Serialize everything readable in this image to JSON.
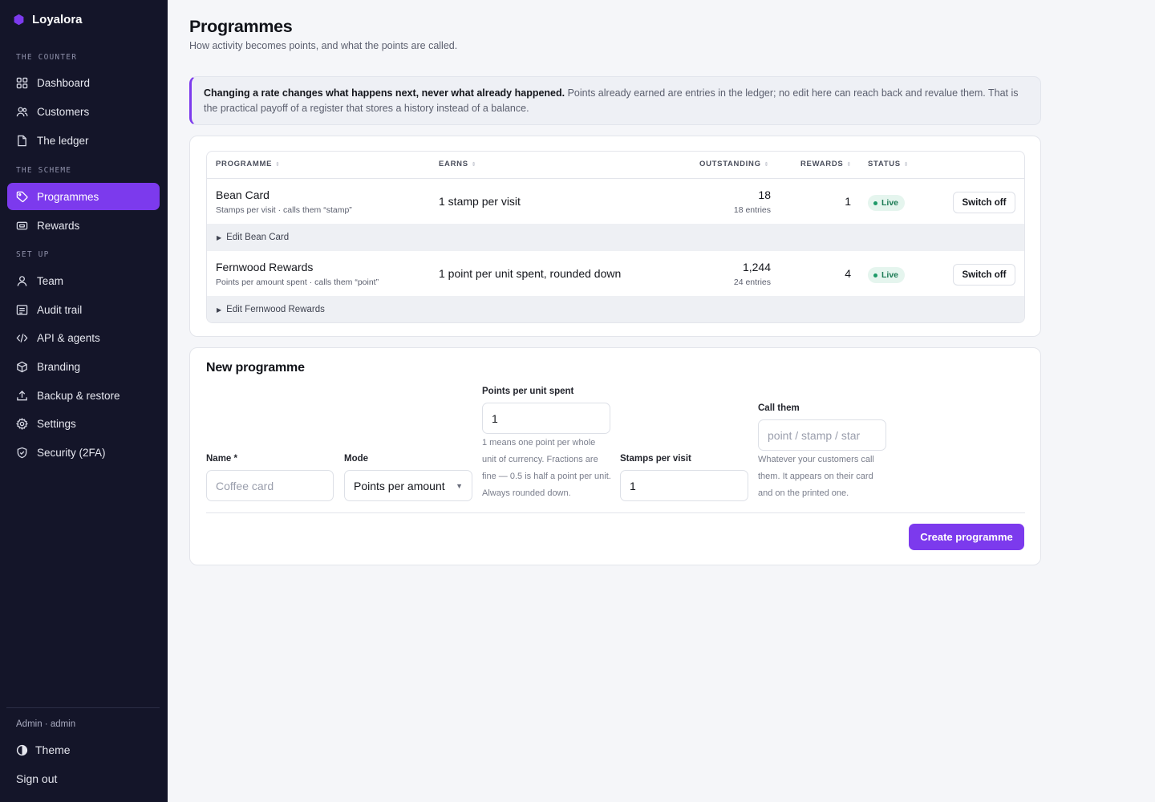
{
  "app": {
    "name": "Loyalora"
  },
  "sidebar": {
    "sections": [
      {
        "label": "THE COUNTER",
        "items": [
          {
            "label": "Dashboard",
            "icon": "grid-icon"
          },
          {
            "label": "Customers",
            "icon": "users-icon"
          },
          {
            "label": "The ledger",
            "icon": "document-icon"
          }
        ]
      },
      {
        "label": "THE SCHEME",
        "items": [
          {
            "label": "Programmes",
            "icon": "tag-icon",
            "active": true
          },
          {
            "label": "Rewards",
            "icon": "ticket-icon"
          }
        ]
      },
      {
        "label": "SET UP",
        "items": [
          {
            "label": "Team",
            "icon": "user-icon"
          },
          {
            "label": "Audit trail",
            "icon": "list-icon"
          },
          {
            "label": "API & agents",
            "icon": "code-icon"
          },
          {
            "label": "Branding",
            "icon": "box-icon"
          },
          {
            "label": "Backup & restore",
            "icon": "upload-icon"
          },
          {
            "label": "Settings",
            "icon": "gear-icon"
          },
          {
            "label": "Security (2FA)",
            "icon": "shield-icon"
          }
        ]
      }
    ],
    "user": "Admin · admin",
    "theme_label": "Theme",
    "signout_label": "Sign out"
  },
  "header": {
    "title": "Programmes",
    "subtitle": "How activity becomes points, and what the points are called."
  },
  "callout": {
    "bold": "Changing a rate changes what happens next, never what already happened.",
    "text": " Points already earned are entries in the ledger; no edit here can reach back and revalue them. That is the practical payoff of a register that stores a history instead of a balance."
  },
  "table": {
    "columns": [
      "PROGRAMME",
      "EARNS",
      "OUTSTANDING",
      "REWARDS",
      "STATUS"
    ],
    "rows": [
      {
        "name": "Bean Card",
        "meta": "Stamps per visit · calls them “stamp”",
        "earns": "1 stamp per visit",
        "outstanding": "18",
        "entries": "18 entries",
        "rewards": "1",
        "status": "Live",
        "action": "Switch off",
        "edit": "Edit Bean Card"
      },
      {
        "name": "Fernwood Rewards",
        "meta": "Points per amount spent · calls them “point”",
        "earns": "1 point per unit spent, rounded down",
        "outstanding": "1,244",
        "entries": "24 entries",
        "rewards": "4",
        "status": "Live",
        "action": "Switch off",
        "edit": "Edit Fernwood Rewards"
      }
    ]
  },
  "form": {
    "title": "New programme",
    "name_label": "Name *",
    "name_placeholder": "Coffee card",
    "mode_label": "Mode",
    "mode_value": "Points per amount",
    "ppu_label": "Points per unit spent",
    "ppu_value": "1",
    "ppu_hint": "1 means one point per whole unit of currency. Fractions are fine — 0.5 is half a point per unit. Always rounded down.",
    "spv_label": "Stamps per visit",
    "spv_value": "1",
    "call_label": "Call them",
    "call_placeholder": "point / stamp / star",
    "call_hint": "Whatever your customers call them. It appears on their card and on the printed one.",
    "submit_label": "Create programme"
  },
  "colors": {
    "accent": "#7c3aed",
    "sidebar_bg": "#141529",
    "live_bg": "#e5f5ee",
    "live_fg": "#1d7b55"
  }
}
